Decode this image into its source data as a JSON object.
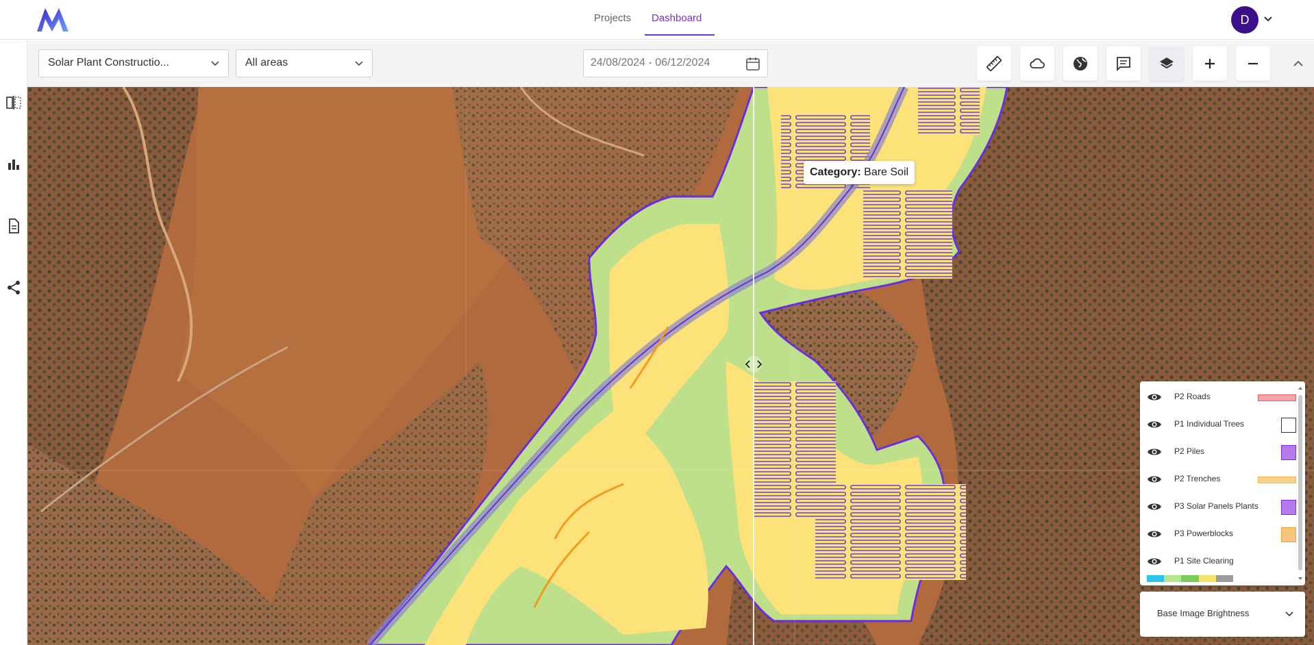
{
  "nav": {
    "tabs": [
      {
        "label": "Projects",
        "active": false
      },
      {
        "label": "Dashboard",
        "active": true
      }
    ],
    "avatar_initial": "D",
    "accent": "#7b2fd6"
  },
  "toolbar": {
    "project_select": "Solar Plant Constructio...",
    "area_select": "All areas",
    "date_range": "24/08/2024 - 06/12/2024",
    "tools": [
      "ruler-icon",
      "cloud-icon",
      "globe-icon",
      "comment-icon",
      "layers-icon",
      "zoom-in-icon",
      "zoom-out-icon"
    ]
  },
  "sidebar": {
    "icons": [
      "compare-view-icon",
      "bar-chart-icon",
      "report-icon",
      "share-icon"
    ]
  },
  "map": {
    "tooltip_label": "Category:",
    "tooltip_value": "Bare Soil"
  },
  "legend": {
    "items": [
      {
        "label": "P2 Roads",
        "color": "#e8606a"
      },
      {
        "label": "P1 Individual Trees",
        "color": "#ffffff"
      },
      {
        "label": "P2 Piles",
        "color": "#b57bee"
      },
      {
        "label": "P2 Trenches",
        "color": "#f8b84e"
      },
      {
        "label": "P3 Solar Panels Plants",
        "color": "#b57bee"
      },
      {
        "label": "P3 Powerblocks",
        "color": "#f9c47d"
      },
      {
        "label": "P1 Site Clearing",
        "color": ""
      }
    ],
    "ramp_colors": [
      "#2cc4ef",
      "#b5e58c",
      "#7ccc5c",
      "#f7e26b",
      "#9b9b9b"
    ]
  },
  "brightness": {
    "label": "Base Image Brightness"
  }
}
